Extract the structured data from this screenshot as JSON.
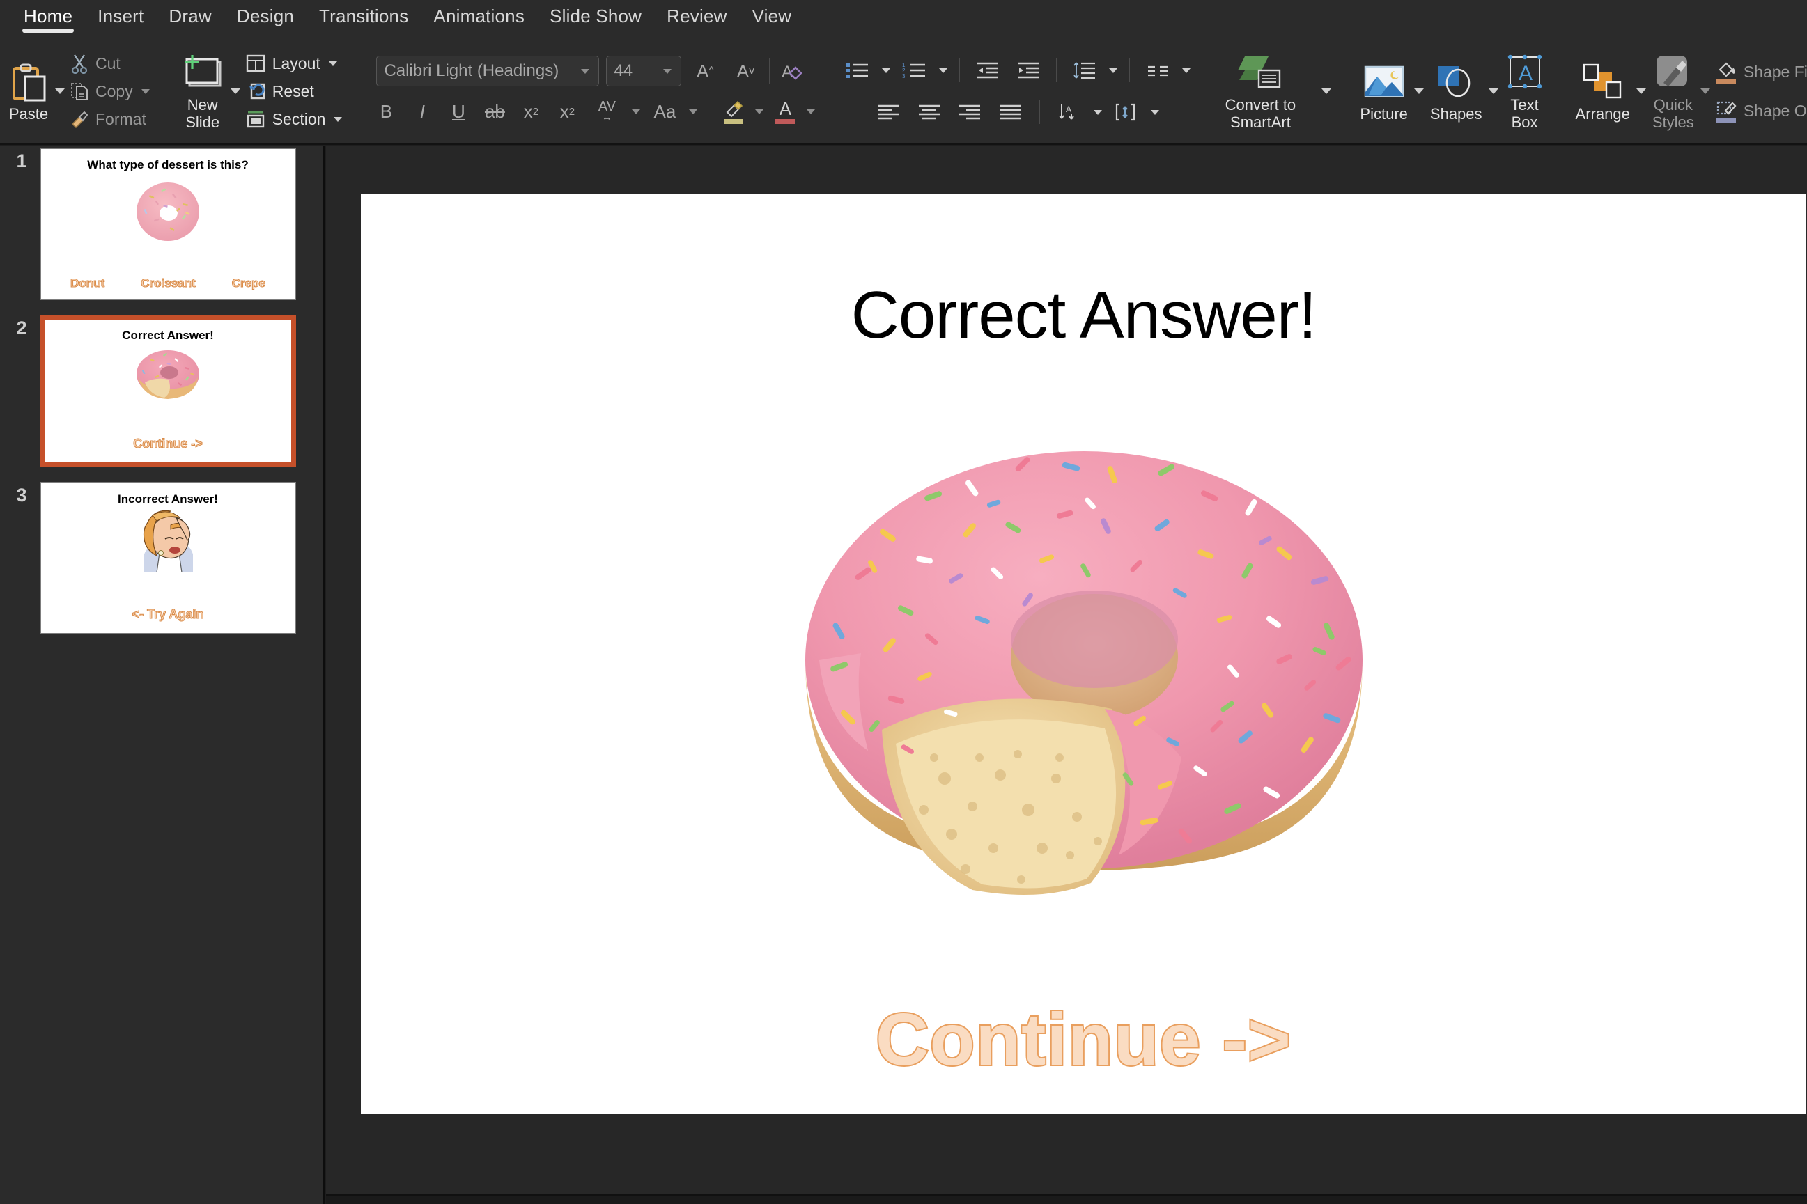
{
  "app": {
    "name": "PowerPoint",
    "accent_color": "#c5502a",
    "ribbon_bg": "#2b2b2b",
    "canvas_bg": "#ffffff"
  },
  "tabs": [
    {
      "label": "Home",
      "active": true
    },
    {
      "label": "Insert",
      "active": false
    },
    {
      "label": "Draw",
      "active": false
    },
    {
      "label": "Design",
      "active": false
    },
    {
      "label": "Transitions",
      "active": false
    },
    {
      "label": "Animations",
      "active": false
    },
    {
      "label": "Slide Show",
      "active": false
    },
    {
      "label": "Review",
      "active": false
    },
    {
      "label": "View",
      "active": false
    }
  ],
  "ribbon": {
    "clipboard": {
      "paste_label": "Paste",
      "cut_label": "Cut",
      "copy_label": "Copy",
      "format_label": "Format"
    },
    "slides": {
      "new_slide_label": "New Slide",
      "layout_label": "Layout",
      "reset_label": "Reset",
      "section_label": "Section"
    },
    "font": {
      "font_name": "Calibri Light (Headings)",
      "font_size": "44",
      "bold": "B",
      "italic": "I",
      "underline": "U",
      "strikethrough": "ab",
      "superscript": "x",
      "subscript": "x",
      "char_spacing": "AV",
      "change_case": "Aa",
      "grow_font": "A",
      "shrink_font": "A",
      "clear_formatting": "A",
      "highlight_color": "#c9c080",
      "font_color": "#c05a5a"
    },
    "paragraph": {
      "bullets": "bullets",
      "numbering": "numbering",
      "decrease_indent": "decrease-indent",
      "increase_indent": "increase-indent",
      "line_spacing": "line-spacing",
      "columns": "columns",
      "align_left": "align-left",
      "align_center": "align-center",
      "align_right": "align-right",
      "justify": "justify",
      "text_direction": "text-direction",
      "align_text": "align-text",
      "convert_label": "Convert to SmartArt"
    },
    "drawing": {
      "picture_label": "Picture",
      "shapes_label": "Shapes",
      "textbox_label": "Text Box",
      "arrange_label": "Arrange",
      "quickstyles_label": "Quick Styles",
      "shape_fill_label": "Shape Fill",
      "shape_outline_label": "Shape Ou"
    }
  },
  "slide_panel": {
    "slides": [
      {
        "number": "1",
        "selected": false,
        "title": "What type of dessert is this?",
        "image": "donut-whole",
        "options": [
          "Donut",
          "Croissant",
          "Crepe"
        ],
        "wordart": ""
      },
      {
        "number": "2",
        "selected": true,
        "title": "Correct Answer!",
        "image": "donut-bitten",
        "options": [],
        "wordart": "Continue ->"
      },
      {
        "number": "3",
        "selected": false,
        "title": "Incorrect Answer!",
        "image": "facepalm-woman",
        "options": [],
        "wordart": "<- Try Again"
      }
    ]
  },
  "main_slide": {
    "title": "Correct Answer!",
    "image": "donut-bitten-pink-sprinkles",
    "wordart": "Continue ->",
    "wordart_fill": "#fadcc2",
    "wordart_outline": "#e99f5e"
  }
}
